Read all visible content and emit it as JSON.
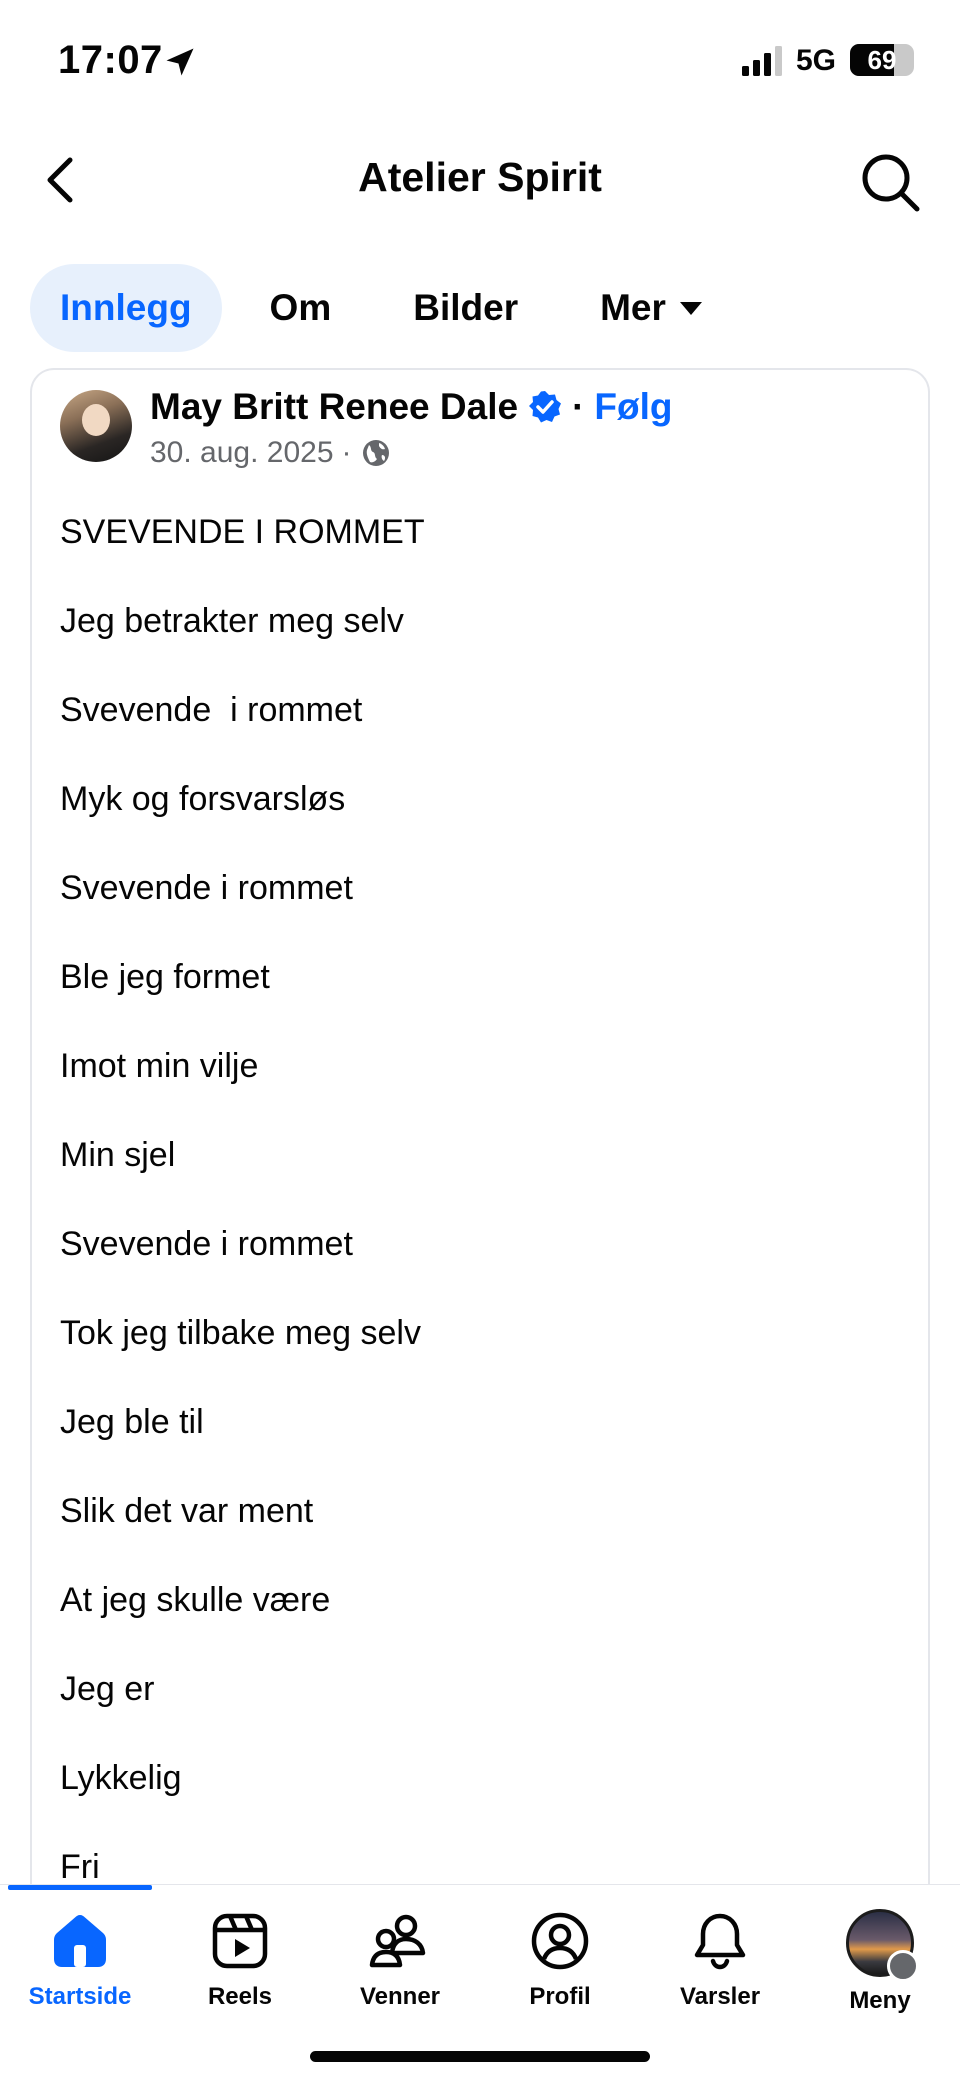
{
  "status_bar": {
    "time": "17:07",
    "network": "5G",
    "battery_percent": 69,
    "battery_text": "69"
  },
  "header": {
    "title": "Atelier Spirit",
    "back_icon": "chevron-left-icon",
    "search_icon": "search-icon"
  },
  "tabs": [
    {
      "label": "Innlegg",
      "active": true
    },
    {
      "label": "Om",
      "active": false
    },
    {
      "label": "Bilder",
      "active": false
    },
    {
      "label": "Mer",
      "active": false,
      "has_caret": true
    }
  ],
  "post": {
    "author": "May Britt Renee Dale",
    "verified": true,
    "separator": "·",
    "follow_label": "Følg",
    "date": "30. aug. 2025",
    "meta_separator": "·",
    "audience_icon": "globe-icon",
    "lines": [
      "SVEVENDE I ROMMET",
      "Jeg betrakter meg selv",
      "Svevende  i rommet",
      "Myk og forsvarsløs",
      "Svevende i rommet",
      "Ble jeg formet",
      "Imot min vilje",
      "Min sjel",
      "Svevende i rommet",
      "Tok jeg tilbake meg selv",
      "Jeg ble til",
      "Slik det var ment",
      "At jeg skulle være",
      "Jeg er",
      "Lykkelig",
      "Fri"
    ]
  },
  "bottom_nav": [
    {
      "label": "Startside",
      "icon": "home-icon",
      "active": true
    },
    {
      "label": "Reels",
      "icon": "reels-icon",
      "active": false
    },
    {
      "label": "Venner",
      "icon": "friends-icon",
      "active": false
    },
    {
      "label": "Profil",
      "icon": "profile-icon",
      "active": false
    },
    {
      "label": "Varsler",
      "icon": "bell-icon",
      "active": false
    },
    {
      "label": "Meny",
      "icon": "menu-avatar-icon",
      "active": false
    }
  ],
  "colors": {
    "accent": "#0866ff",
    "active_tab_bg": "#e7f0fc",
    "text": "#050505",
    "secondary_text": "#65676b"
  }
}
